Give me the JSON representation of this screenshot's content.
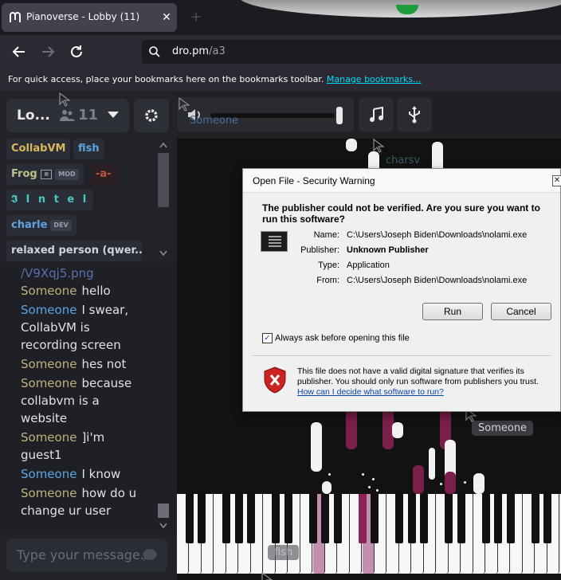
{
  "browser": {
    "tab_title": "Pianoverse - Lobby (11)",
    "url_host": "dro.pm",
    "url_path": "/a3",
    "bookmarks_text": "For quick access, place your bookmarks here on the bookmarks toolbar.",
    "bookmarks_link": "Manage bookmarks..."
  },
  "room": {
    "name": "Lo...",
    "user_count": "11"
  },
  "users": [
    {
      "name": "CollabVM",
      "color": "#d8b65a"
    },
    {
      "name": "fish",
      "color": "#5ea4e0"
    },
    {
      "name": "Frog",
      "color": "#b9c487",
      "badge": "MOD"
    },
    {
      "name": "-a-",
      "color": "#c0563b"
    },
    {
      "name": "𝕴 I n t e l",
      "color": "#48c7c0"
    },
    {
      "name": "charle",
      "color": "#5ea4e0",
      "badge": "DEV"
    },
    {
      "name": "relaxed person (qwer...",
      "color": "#cfd3da"
    }
  ],
  "chat": {
    "partial_top": "/V9Xqj5.png",
    "messages": [
      {
        "name": "Someone",
        "color": "gold",
        "text": "hello"
      },
      {
        "name": "Someone",
        "color": "blue",
        "text": "I swear, CollabVM is recording screen"
      },
      {
        "name": "Someone",
        "color": "gold",
        "text": "hes not"
      },
      {
        "name": "Someone",
        "color": "gold",
        "text": "because collabvm is a website"
      },
      {
        "name": "Someone",
        "color": "gold",
        "text": "]i'm guest1"
      },
      {
        "name": "Someone",
        "color": "blue",
        "text": "I know"
      },
      {
        "name": "Someone",
        "color": "gold",
        "text": "how do u change ur user"
      }
    ],
    "input_placeholder": "Type your message..."
  },
  "cursors": {
    "someone_faded": "Someone",
    "charsv": "charsv",
    "someone_label": "Someone",
    "fish_label": "fish"
  },
  "dialog": {
    "title": "Open File - Security Warning",
    "question": "The publisher could not be verified.  Are you sure you want to run this software?",
    "rows": [
      {
        "label": "Name:",
        "value": "C:\\Users\\Joseph Biden\\Downloads\\nolami.exe",
        "bold": false
      },
      {
        "label": "Publisher:",
        "value": "Unknown Publisher",
        "bold": true
      },
      {
        "label": "Type:",
        "value": "Application",
        "bold": false
      },
      {
        "label": "From:",
        "value": "C:\\Users\\Joseph Biden\\Downloads\\nolami.exe",
        "bold": false
      }
    ],
    "run_label": "Run",
    "cancel_label": "Cancel",
    "checkbox_label": "Always ask before opening this file",
    "checkbox_checked": true,
    "warning_text": "This file does not have a valid digital signature that verifies its publisher.  You should only run software from publishers you trust.",
    "warning_link": "How can I decide what software to run?"
  }
}
